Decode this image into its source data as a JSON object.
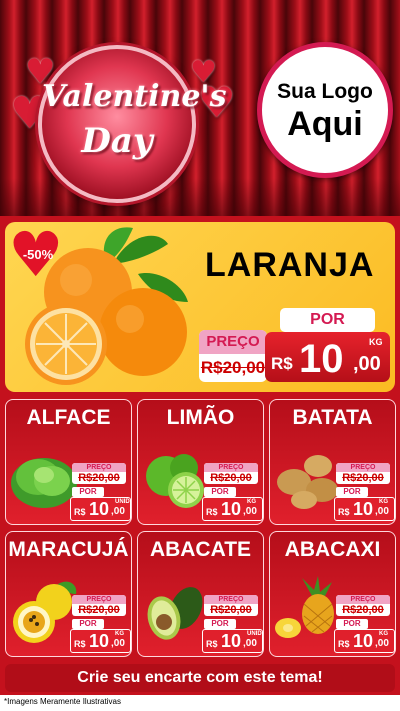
{
  "header": {
    "valentine_line1": "Valentine's",
    "valentine_line2": "Day",
    "logo_line1": "Sua Logo",
    "logo_line2": "Aqui"
  },
  "featured": {
    "discount": "-50%",
    "name": "LARANJA",
    "preco_label": "PREÇO",
    "old_price": "R$20,00",
    "por_label": "POR",
    "currency": "R$",
    "price_int": "10",
    "price_cents": ",00",
    "unit": "KG"
  },
  "products": [
    {
      "name": "ALFACE",
      "preco_label": "PREÇO",
      "old_price": "R$20,00",
      "por_label": "POR",
      "currency": "R$",
      "price_int": "10",
      "price_cents": ",00",
      "unit": "UNID"
    },
    {
      "name": "LIMÃO",
      "preco_label": "PREÇO",
      "old_price": "R$20,00",
      "por_label": "POR",
      "currency": "R$",
      "price_int": "10",
      "price_cents": ",00",
      "unit": "KG"
    },
    {
      "name": "BATATA",
      "preco_label": "PREÇO",
      "old_price": "R$20,00",
      "por_label": "POR",
      "currency": "R$",
      "price_int": "10",
      "price_cents": ",00",
      "unit": "KG"
    },
    {
      "name": "MARACUJÁ",
      "preco_label": "PREÇO",
      "old_price": "R$20,00",
      "por_label": "POR",
      "currency": "R$",
      "price_int": "10",
      "price_cents": ",00",
      "unit": "KG"
    },
    {
      "name": "ABACATE",
      "preco_label": "PREÇO",
      "old_price": "R$20,00",
      "por_label": "POR",
      "currency": "R$",
      "price_int": "10",
      "price_cents": ",00",
      "unit": "UNID"
    },
    {
      "name": "ABACAXI",
      "preco_label": "PREÇO",
      "old_price": "R$20,00",
      "por_label": "POR",
      "currency": "R$",
      "price_int": "10",
      "price_cents": ",00",
      "unit": "KG"
    }
  ],
  "cta": "Crie seu encarte com este tema!",
  "disclaimer": "*Imagens Meramente Ilustrativas",
  "colors": {
    "brand_red": "#c4111d",
    "featured_bg": "#fbbb22",
    "logo_border": "#d41a52"
  },
  "icons": [
    "heart-icon",
    "orange-image",
    "lettuce-image",
    "lime-image",
    "potato-image",
    "passion-fruit-image",
    "avocado-image",
    "pineapple-image"
  ]
}
